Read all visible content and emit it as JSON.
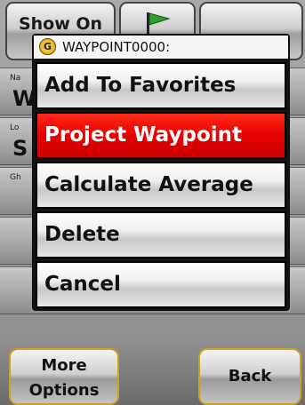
{
  "background": {
    "top_left_button": "Show On",
    "flag_icon": "flag-icon",
    "rows": [
      {
        "label": "Na",
        "value": "W"
      },
      {
        "label": "Lo",
        "value": "S"
      },
      {
        "label": "Gh",
        "value": ""
      }
    ],
    "more_options_line1": "More",
    "more_options_line2": "Options",
    "back_label": "Back"
  },
  "menu": {
    "title": "WAYPOINT0000:",
    "logo_letter": "G",
    "items": [
      {
        "label": "Add To Favorites",
        "selected": false
      },
      {
        "label": "Project Waypoint",
        "selected": true
      },
      {
        "label": "Calculate Average",
        "selected": false
      },
      {
        "label": "Delete",
        "selected": false
      },
      {
        "label": "Cancel",
        "selected": false
      }
    ]
  },
  "colors": {
    "selected": "#e60000",
    "accent_border": "#c9a227"
  }
}
